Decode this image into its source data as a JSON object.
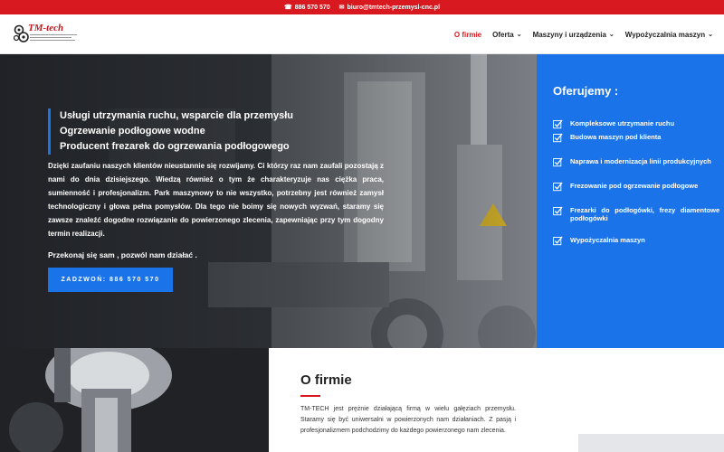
{
  "topbar": {
    "phone": "886 570 570",
    "email": "biuro@tmtech-przemysl-cnc.pl",
    "phone_icon": "phone-icon",
    "email_icon": "envelope-icon"
  },
  "logo": {
    "brand": "TM-tech"
  },
  "nav": {
    "items": [
      {
        "label": "O firmie",
        "active": true,
        "dropdown": false
      },
      {
        "label": "Oferta",
        "active": false,
        "dropdown": true
      },
      {
        "label": "Maszyny i urządzenia",
        "active": false,
        "dropdown": true
      },
      {
        "label": "Wypożyczalnia maszyn",
        "active": false,
        "dropdown": true
      }
    ]
  },
  "hero": {
    "heading": [
      "Usługi utrzymania ruchu, wsparcie dla przemysłu",
      "Ogrzewanie podłogowe wodne",
      "Producent frezarek do ogrzewania podłogowego"
    ],
    "text": "Dzięki zaufaniu naszych klientów nieustannie się rozwijamy. Ci którzy raz nam zaufali pozostają z nami do dnia dzisiejszego. Wiedzą również o tym że charakteryzuje nas ciężka praca, sumienność i profesjonalizm. Park maszynowy to nie wszystko, potrzebny jest również zamysł technologiczny i głowa pełna pomysłów. Dla tego nie boimy się nowych wyzwań, staramy się zawsze znaleźć dogodne rozwiązanie do powierzonego zlecenia, zapewniając przy tym dogodny termin realizacji.",
    "sub": "Przekonaj się sam , pozwól nam działać .",
    "cta": "ZADZWOŃ: 886 570 570"
  },
  "offer": {
    "title": "Oferujemy :",
    "items": [
      "Kompleksowe utrzymanie ruchu",
      "Budowa maszyn pod klienta",
      "Naprawa i modernizacja linii produkcyjnych",
      "Frezowanie pod ogrzewanie podłogowe",
      "Frezarki do podłogówki, frezy diamentowe do podłogówki",
      "Wypożyczalnia maszyn"
    ],
    "check_icon": "checkbox-check-icon"
  },
  "about": {
    "title": "O firmie",
    "text": "TM-TECH jest prężnie działającą firmą w wielu gałęziach przemysłu. Staramy się być uniwersalni w powierzonych nam działaniach. Z pasją i profesjonalizmem podchodzimy do każdego powierzonego nam zlecenia."
  },
  "colors": {
    "brand_red": "#d8191f",
    "accent_blue": "#1a73e8"
  }
}
